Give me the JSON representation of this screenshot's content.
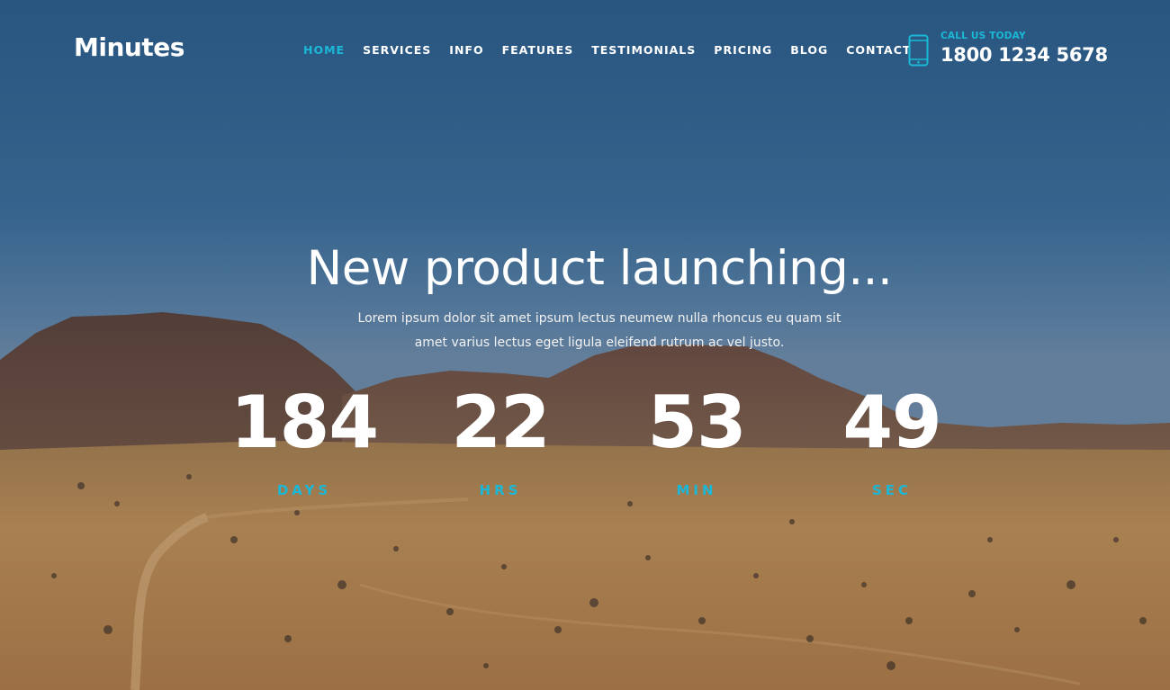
{
  "brand": {
    "name": "Minutes"
  },
  "nav": {
    "items": [
      {
        "label": "HOME",
        "active": true
      },
      {
        "label": "SERVICES",
        "active": false
      },
      {
        "label": "INFO",
        "active": false
      },
      {
        "label": "FEATURES",
        "active": false
      },
      {
        "label": "TESTIMONIALS",
        "active": false
      },
      {
        "label": "PRICING",
        "active": false
      },
      {
        "label": "BLOG",
        "active": false
      },
      {
        "label": "CONTACT",
        "active": false
      }
    ]
  },
  "contact": {
    "label": "CALL US TODAY",
    "phone": "1800 1234 5678",
    "icon": "smartphone-icon"
  },
  "hero": {
    "headline": "New product launching...",
    "subtext": "Lorem ipsum dolor sit amet ipsum lectus neumew nulla rhoncus eu quam sit amet varius lectus eget ligula eleifend rutrum ac vel justo."
  },
  "countdown": {
    "days": {
      "value": "184",
      "label": "DAYS"
    },
    "hours": {
      "value": "22",
      "label": "HRS"
    },
    "minutes": {
      "value": "53",
      "label": "MIN"
    },
    "seconds": {
      "value": "49",
      "label": "SEC"
    }
  },
  "colors": {
    "accent": "#1ab8d6",
    "text": "#ffffff",
    "sky_top": "#2f5f86",
    "desert": "#b98a52"
  }
}
